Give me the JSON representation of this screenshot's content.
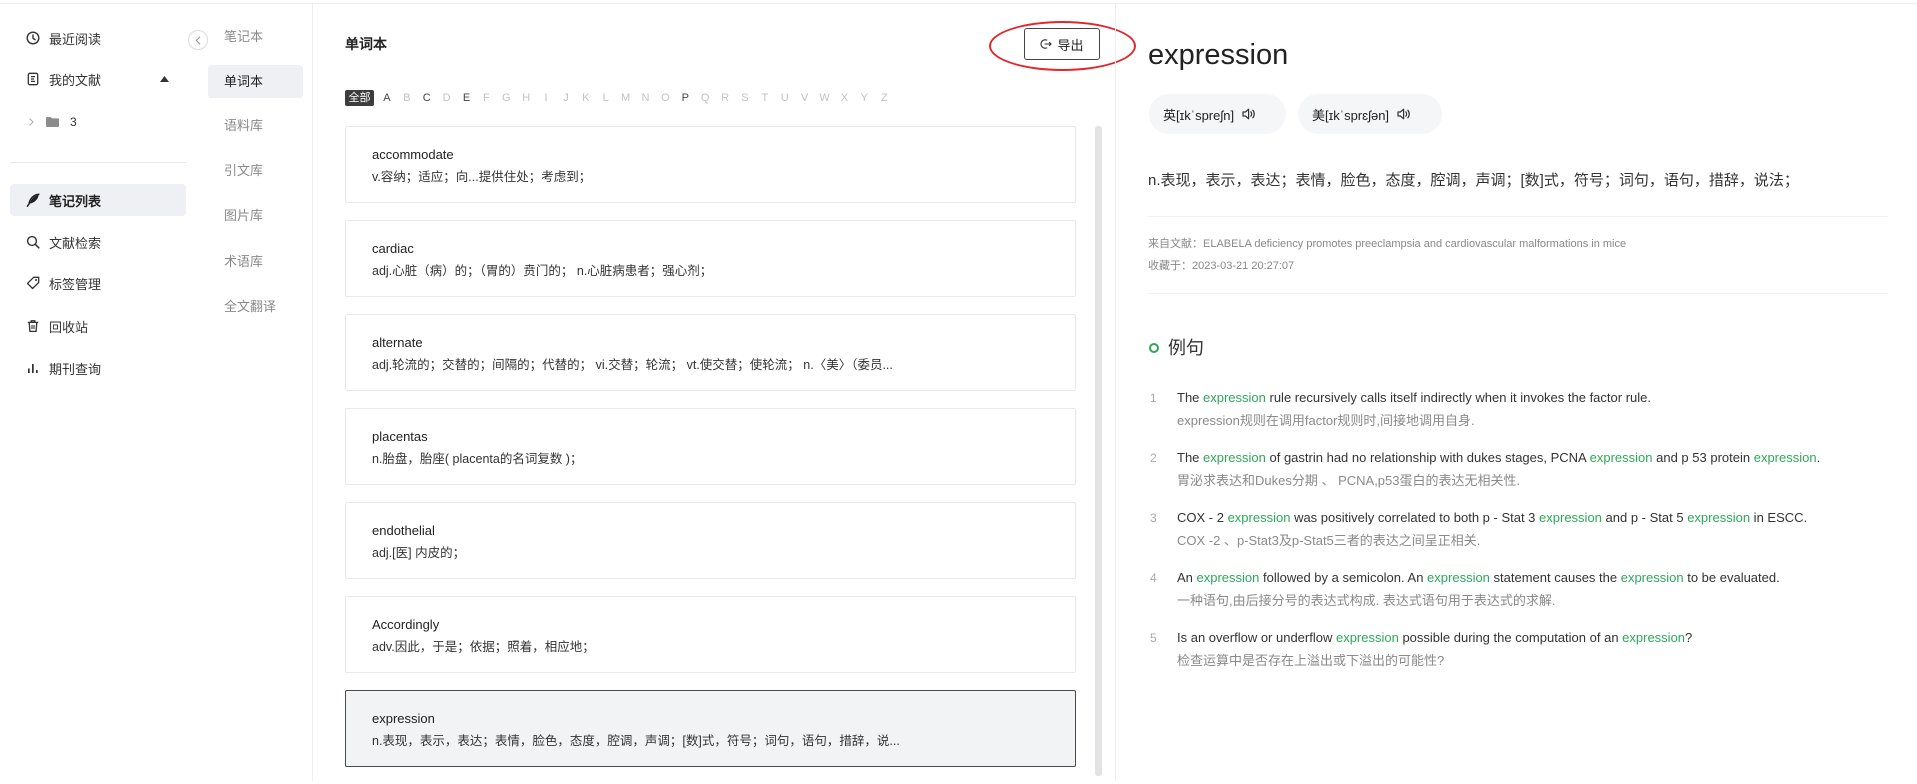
{
  "sidebar": {
    "collapse_icon": "chevron-left-icon",
    "recent": {
      "label": "最近阅读",
      "icon": "clock-icon"
    },
    "library": {
      "label": "我的文献",
      "icon": "document-icon",
      "expanded": true
    },
    "folder": {
      "label": "3",
      "icon": "folder-icon"
    },
    "nav": [
      {
        "label": "笔记列表",
        "icon": "feather-pen-icon",
        "active": true
      },
      {
        "label": "文献检索",
        "icon": "search-icon"
      },
      {
        "label": "标签管理",
        "icon": "tag-icon"
      },
      {
        "label": "回收站",
        "icon": "trash-icon"
      },
      {
        "label": "期刊查询",
        "icon": "bar-chart-icon"
      }
    ]
  },
  "subnav": {
    "items": [
      {
        "label": "笔记本"
      },
      {
        "label": "单词本",
        "active": true
      },
      {
        "label": "语料库"
      },
      {
        "label": "引文库"
      },
      {
        "label": "图片库"
      },
      {
        "label": "术语库"
      },
      {
        "label": "全文翻译"
      }
    ]
  },
  "wordbook": {
    "title": "单词本",
    "export_label": "导出",
    "export_icon": "export-icon",
    "filter": {
      "all_label": "全部",
      "letters": [
        {
          "letter": "A",
          "has_words": true
        },
        {
          "letter": "B",
          "has_words": false
        },
        {
          "letter": "C",
          "has_words": true
        },
        {
          "letter": "D",
          "has_words": false
        },
        {
          "letter": "E",
          "has_words": true
        },
        {
          "letter": "F",
          "has_words": false
        },
        {
          "letter": "G",
          "has_words": false
        },
        {
          "letter": "H",
          "has_words": false
        },
        {
          "letter": "I",
          "has_words": false
        },
        {
          "letter": "J",
          "has_words": false
        },
        {
          "letter": "K",
          "has_words": false
        },
        {
          "letter": "L",
          "has_words": false
        },
        {
          "letter": "M",
          "has_words": false
        },
        {
          "letter": "N",
          "has_words": false
        },
        {
          "letter": "O",
          "has_words": false
        },
        {
          "letter": "P",
          "has_words": true
        },
        {
          "letter": "Q",
          "has_words": false
        },
        {
          "letter": "R",
          "has_words": false
        },
        {
          "letter": "S",
          "has_words": false
        },
        {
          "letter": "T",
          "has_words": false
        },
        {
          "letter": "U",
          "has_words": false
        },
        {
          "letter": "V",
          "has_words": false
        },
        {
          "letter": "W",
          "has_words": false
        },
        {
          "letter": "X",
          "has_words": false
        },
        {
          "letter": "Y",
          "has_words": false
        },
        {
          "letter": "Z",
          "has_words": false
        }
      ]
    },
    "words": [
      {
        "word": "accommodate",
        "definition": "v.容纳；适应；向...提供住处；考虑到；"
      },
      {
        "word": "cardiac",
        "definition": "adj.心脏（病）的；（胃的）贲门的； n.心脏病患者；强心剂；"
      },
      {
        "word": "alternate",
        "definition": "adj.轮流的；交替的；间隔的；代替的； vi.交替；轮流； vt.使交替；使轮流； n.〈美〉（委员..."
      },
      {
        "word": "placentas",
        "definition": "n.胎盘，胎座( placenta的名词复数 )；"
      },
      {
        "word": "endothelial",
        "definition": "adj.[医] 内皮的；"
      },
      {
        "word": "Accordingly",
        "definition": "adv.因此，于是；依据；照着，相应地；"
      },
      {
        "word": "expression",
        "definition": "n.表现，表示，表达；表情，脸色，态度，腔调，声调；[数]式，符号；词句，语句，措辞，说...",
        "selected": true
      }
    ]
  },
  "detail": {
    "word": "expression",
    "pronunciations": [
      {
        "label": "英[ɪkˈspreʃn]",
        "icon": "speaker-icon"
      },
      {
        "label": "美[ɪkˈsprɛʃən]",
        "icon": "speaker-icon"
      }
    ],
    "definition": "n.表现，表示，表达；表情，脸色，态度，腔调，声调；[数]式，符号；词句，语句，措辞，说法；",
    "source_label": "来自文献：",
    "source": "ELABELA deficiency promotes preeclampsia and cardiovascular malformations in mice",
    "saved_label": "收藏于：",
    "saved_at": "2023-03-21 20:27:07",
    "examples_title": "例句",
    "examples": [
      {
        "num": "1",
        "en": [
          {
            "text": "The "
          },
          {
            "text": "expression",
            "highlight": true
          },
          {
            "text": " rule recursively calls itself indirectly when it invokes the factor rule."
          }
        ],
        "zh": "expression规则在调用factor规则时,间接地调用自身."
      },
      {
        "num": "2",
        "en": [
          {
            "text": "The "
          },
          {
            "text": "expression",
            "highlight": true
          },
          {
            "text": " of gastrin had no relationship with dukes stages, PCNA "
          },
          {
            "text": "expression",
            "highlight": true
          },
          {
            "text": " and p 53 protein "
          },
          {
            "text": "expression",
            "highlight": true
          },
          {
            "text": "."
          }
        ],
        "zh": "胃泌求表达和Dukes分期 、 PCNA,p53蛋白的表达无相关性."
      },
      {
        "num": "3",
        "en": [
          {
            "text": "COX - 2 "
          },
          {
            "text": "expression",
            "highlight": true
          },
          {
            "text": " was positively correlated to both p - Stat 3 "
          },
          {
            "text": "expression",
            "highlight": true
          },
          {
            "text": " and p - Stat 5 "
          },
          {
            "text": "expression",
            "highlight": true
          },
          {
            "text": " in ESCC."
          }
        ],
        "zh": "COX -2 、p-Stat3及p-Stat5三者的表达之间呈正相关."
      },
      {
        "num": "4",
        "en": [
          {
            "text": "An "
          },
          {
            "text": "expression",
            "highlight": true
          },
          {
            "text": " followed by a semicolon. An "
          },
          {
            "text": "expression",
            "highlight": true
          },
          {
            "text": " statement causes the "
          },
          {
            "text": "expression",
            "highlight": true
          },
          {
            "text": " to be evaluated."
          }
        ],
        "zh": "一种语句,由后接分号的表达式构成. 表达式语句用于表达式的求解."
      },
      {
        "num": "5",
        "en": [
          {
            "text": "Is an overflow or underflow "
          },
          {
            "text": "expression",
            "highlight": true
          },
          {
            "text": " possible during the computation of an "
          },
          {
            "text": "expression",
            "highlight": true
          },
          {
            "text": "?"
          }
        ],
        "zh": "检查运算中是否存在上溢出或下溢出的可能性?"
      }
    ]
  },
  "colors": {
    "accent_green": "#2fa85a",
    "annotation_ring": "#e3262b",
    "selected_bg": "#eef0f3"
  }
}
